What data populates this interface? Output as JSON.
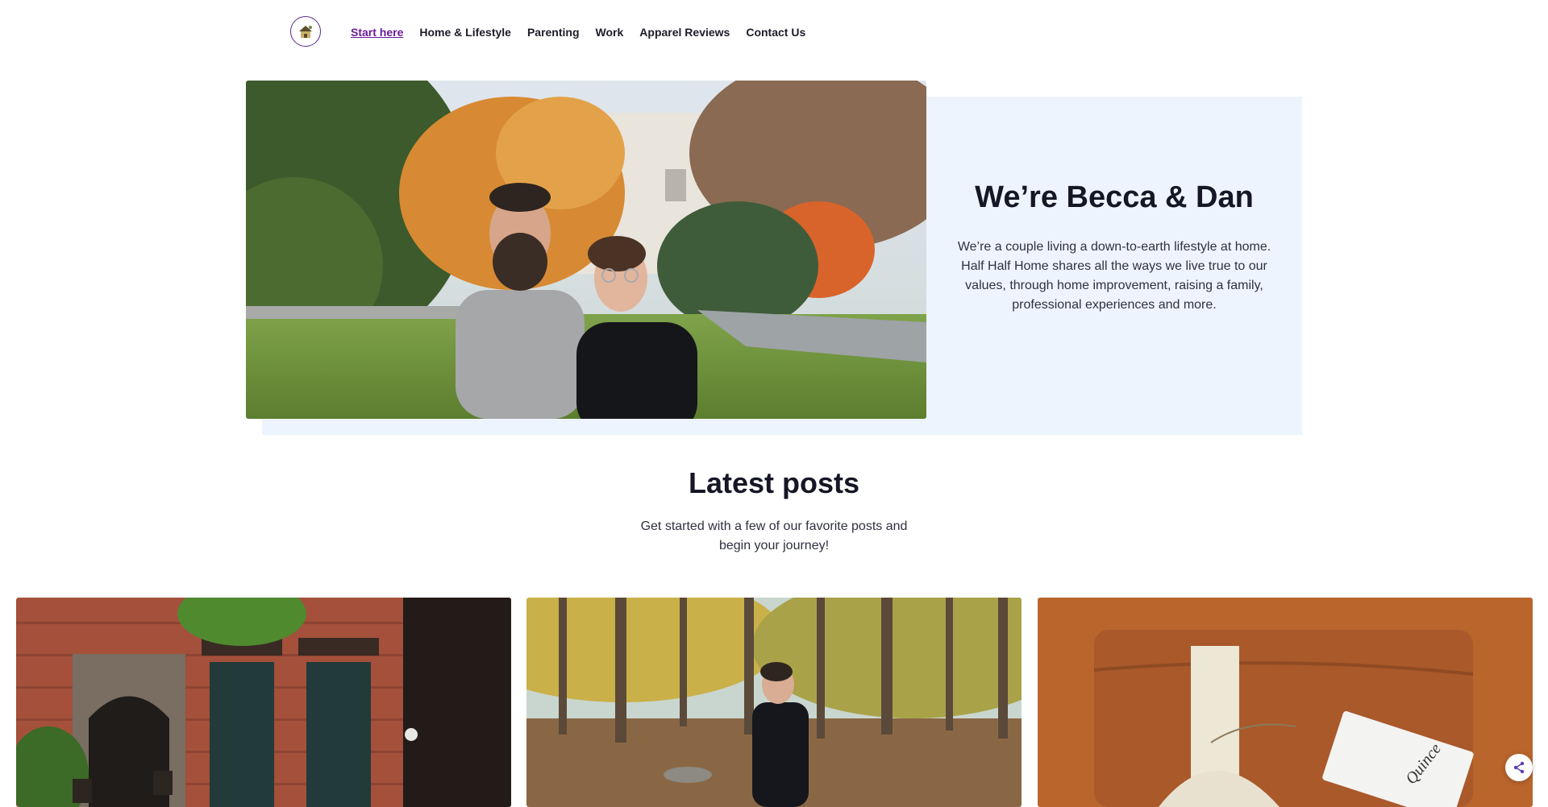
{
  "header": {
    "logo_icon": "house-logo-icon",
    "nav": [
      {
        "label": "Start here",
        "active": true
      },
      {
        "label": "Home & Lifestyle"
      },
      {
        "label": "Parenting"
      },
      {
        "label": "Work"
      },
      {
        "label": "Apparel Reviews"
      },
      {
        "label": "Contact Us"
      }
    ]
  },
  "hero": {
    "title": "We’re Becca & Dan",
    "description": "We’re a couple living a down-to-earth lifestyle at home. Half Half Home shares all the ways we live true to our values, through home improvement, raising a family, professional experiences and more.",
    "photo": "couple-portrait-autumn-photo"
  },
  "latest": {
    "title": "Latest posts",
    "subtitle": "Get started with a few of our favorite posts and begin your journey!"
  },
  "posts": [
    {
      "image": "brick-brownstone-photo"
    },
    {
      "image": "autumn-forest-photo"
    },
    {
      "image": "folded-linen-photo",
      "tag_text": "Quince"
    }
  ],
  "share_button": {
    "icon": "share-icon"
  },
  "colors": {
    "accent": "#6a1b9a",
    "hero_panel": "#eef4fd",
    "text": "#161726"
  }
}
